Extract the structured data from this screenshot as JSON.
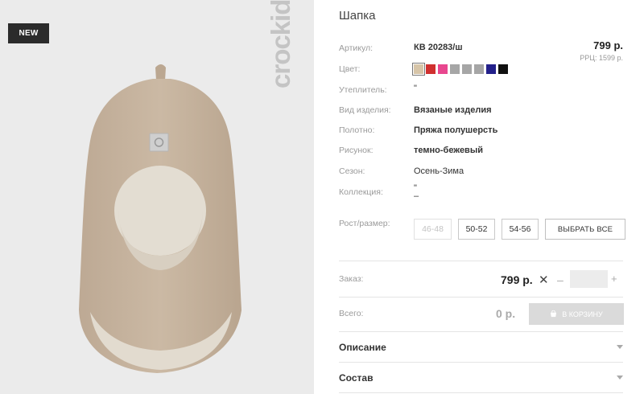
{
  "product": {
    "badge": "NEW",
    "brand_watermark": "crockid",
    "title": "Шапка",
    "price": "799 р.",
    "rrp": "РРЦ: 1599 р."
  },
  "attributes": [
    {
      "label": "Артикул:",
      "value": "КВ 20283/ш"
    },
    {
      "label": "Цвет:",
      "value": ""
    },
    {
      "label": "Утеплитель:",
      "value": "\""
    },
    {
      "label": "Вид изделия:",
      "value": "Вязаные изделия"
    },
    {
      "label": "Полотно:",
      "value": "Пряжа полушерсть"
    },
    {
      "label": "Рисунок:",
      "value": "темно-бежевый"
    },
    {
      "label": "Сезон:",
      "value": "Осень-Зима"
    },
    {
      "label": "Коллекция:",
      "value": "\""
    }
  ],
  "colors": [
    "#d7c5a8",
    "#d0302f",
    "#e8478f",
    "#a6a6a6",
    "#a6a6a6",
    "#a6a6a6",
    "#23208a",
    "#111111"
  ],
  "sizes": {
    "label": "Рост/размер:",
    "options": [
      "46-48",
      "50-52",
      "54-56"
    ],
    "select_all": "ВЫБРАТЬ ВСЕ"
  },
  "order": {
    "label": "Заказ:",
    "price": "799 р.",
    "times": "✕",
    "minus": "–",
    "plus": "+",
    "quantity": ""
  },
  "total": {
    "label": "Всего:",
    "value": "0 р.",
    "cart_button": "В КОРЗИНУ"
  },
  "accordion": {
    "description": "Описание",
    "composition": "Состав"
  }
}
